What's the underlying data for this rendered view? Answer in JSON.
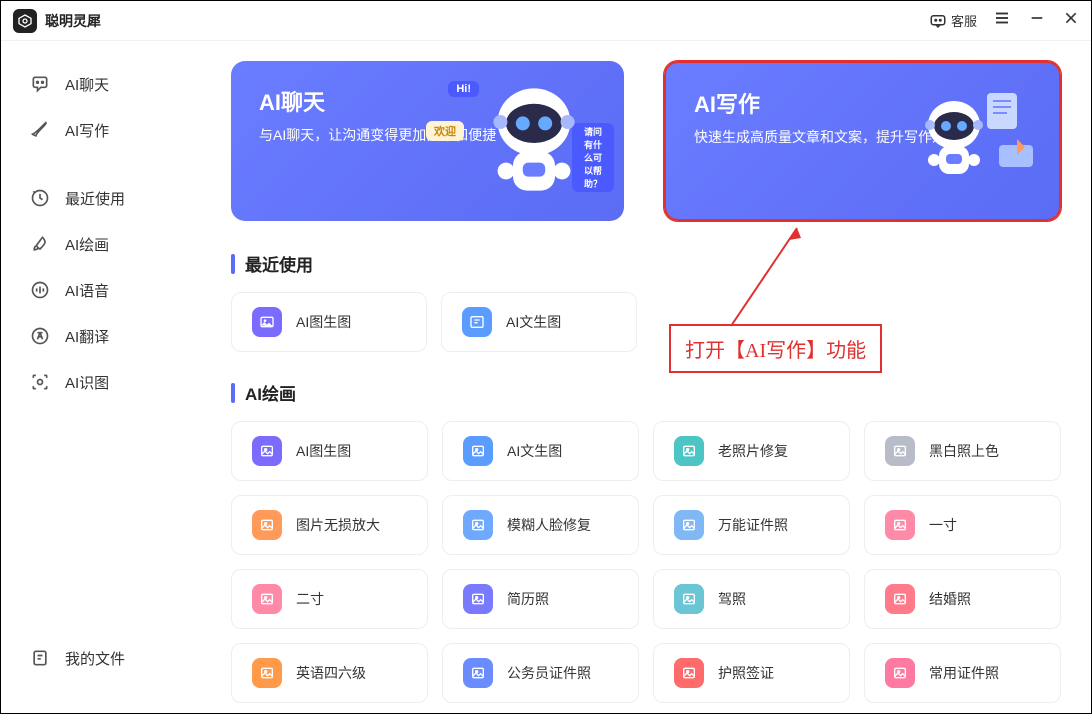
{
  "app": {
    "title": "聪明灵犀",
    "customer_service": "客服"
  },
  "sidebar": {
    "items": [
      {
        "label": "AI聊天",
        "icon": "chat"
      },
      {
        "label": "AI写作",
        "icon": "pen"
      },
      {
        "label": "最近使用",
        "icon": "clock"
      },
      {
        "label": "AI绘画",
        "icon": "brush"
      },
      {
        "label": "AI语音",
        "icon": "voice"
      },
      {
        "label": "AI翻译",
        "icon": "translate"
      },
      {
        "label": "AI识图",
        "icon": "scan"
      }
    ],
    "footer": {
      "label": "我的文件",
      "icon": "file"
    }
  },
  "hero": {
    "cards": [
      {
        "title": "AI聊天",
        "sub": "与AI聊天，让沟通变得更加简单和便捷",
        "bubble_hi": "Hi!",
        "bubble_welcome": "欢迎",
        "bubble_help": "请问有什么可以帮助？"
      },
      {
        "title": "AI写作",
        "sub": "快速生成高质量文章和文案，提升写作效率"
      }
    ]
  },
  "sections": {
    "recent": {
      "title": "最近使用",
      "tiles": [
        {
          "label": "AI图生图",
          "color": "purple"
        },
        {
          "label": "AI文生图",
          "color": "blue"
        }
      ]
    },
    "paint": {
      "title": "AI绘画",
      "tiles": [
        {
          "label": "AI图生图",
          "color": "purple"
        },
        {
          "label": "AI文生图",
          "color": "blue"
        },
        {
          "label": "老照片修复",
          "color": "teal"
        },
        {
          "label": "黑白照上色",
          "color": "gray"
        },
        {
          "label": "图片无损放大",
          "color": "orange"
        },
        {
          "label": "模糊人脸修复",
          "color": "lblue"
        },
        {
          "label": "万能证件照",
          "color": "sky"
        },
        {
          "label": "一寸",
          "color": "pink"
        },
        {
          "label": "二寸",
          "color": "pink"
        },
        {
          "label": "简历照",
          "color": "indigo"
        },
        {
          "label": "驾照",
          "color": "cyan"
        },
        {
          "label": "结婚照",
          "color": "red"
        },
        {
          "label": "英语四六级",
          "color": "or2"
        },
        {
          "label": "公务员证件照",
          "color": "blue2"
        },
        {
          "label": "护照签证",
          "color": "red2"
        },
        {
          "label": "常用证件照",
          "color": "pink2"
        }
      ]
    }
  },
  "annotation": {
    "text": "打开【AI写作】功能"
  }
}
